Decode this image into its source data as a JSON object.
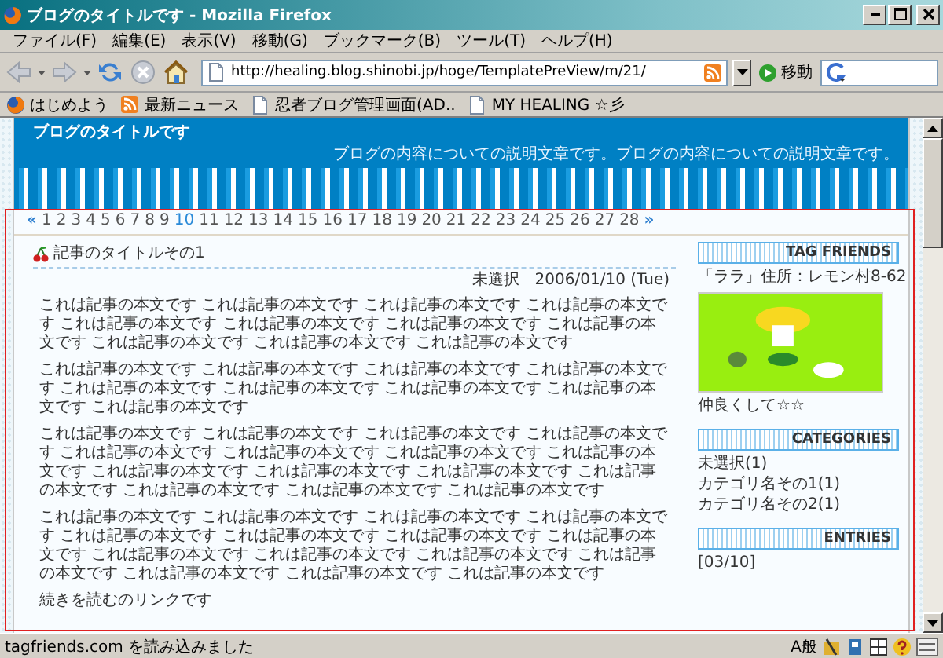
{
  "window": {
    "title": "ブログのタイトルです - Mozilla Firefox"
  },
  "menu": [
    "ファイル(F)",
    "編集(E)",
    "表示(V)",
    "移動(G)",
    "ブックマーク(B)",
    "ツール(T)",
    "ヘルプ(H)"
  ],
  "address_bar": {
    "value": "http://healing.blog.shinobi.jp/hoge/TemplatePreView/m/21/"
  },
  "go_button": "移動",
  "bookmarks": [
    {
      "label": "はじめよう",
      "kind": "browser"
    },
    {
      "label": "最新ニュース",
      "kind": "feed"
    },
    {
      "label": "忍者ブログ管理画面(AD..",
      "kind": "page"
    },
    {
      "label": "MY HEALING ☆彡",
      "kind": "page"
    }
  ],
  "blog": {
    "title": "ブログのタイトルです",
    "description": "ブログの内容についての説明文章です。ブログの内容についての説明文章です。"
  },
  "pager": {
    "prev": "«",
    "next": "»",
    "pages": [
      {
        "label": "1",
        "selected": false
      },
      {
        "label": "2",
        "selected": false
      },
      {
        "label": "3",
        "selected": false
      },
      {
        "label": "4",
        "selected": false
      },
      {
        "label": "5",
        "selected": false
      },
      {
        "label": "6",
        "selected": false
      },
      {
        "label": "7",
        "selected": false
      },
      {
        "label": "8",
        "selected": false
      },
      {
        "label": "9",
        "selected": false
      },
      {
        "label": "10",
        "selected": true
      },
      {
        "label": "11",
        "selected": false
      },
      {
        "label": "12",
        "selected": false
      },
      {
        "label": "13",
        "selected": false
      },
      {
        "label": "14",
        "selected": false
      },
      {
        "label": "15",
        "selected": false
      },
      {
        "label": "16",
        "selected": false
      },
      {
        "label": "17",
        "selected": false
      },
      {
        "label": "18",
        "selected": false
      },
      {
        "label": "19",
        "selected": false
      },
      {
        "label": "20",
        "selected": false
      },
      {
        "label": "21",
        "selected": false
      },
      {
        "label": "22",
        "selected": false
      },
      {
        "label": "23",
        "selected": false
      },
      {
        "label": "24",
        "selected": false
      },
      {
        "label": "25",
        "selected": false
      },
      {
        "label": "26",
        "selected": false
      },
      {
        "label": "27",
        "selected": false
      },
      {
        "label": "28",
        "selected": false
      }
    ]
  },
  "entry": {
    "title": "記事のタイトルその1",
    "category": "未選択",
    "date": "2006/01/10 (Tue)",
    "paragraphs": [
      "これは記事の本文です これは記事の本文です これは記事の本文です これは記事の本文です これは記事の本文です これは記事の本文です これは記事の本文です これは記事の本文です これは記事の本文です これは記事の本文です これは記事の本文です",
      "これは記事の本文です これは記事の本文です これは記事の本文です これは記事の本文です これは記事の本文です これは記事の本文です これは記事の本文です これは記事の本文です これは記事の本文です",
      "これは記事の本文です これは記事の本文です これは記事の本文です これは記事の本文です これは記事の本文です これは記事の本文です これは記事の本文です これは記事の本文です これは記事の本文です これは記事の本文です これは記事の本文です これは記事の本文です これは記事の本文です これは記事の本文です これは記事の本文です",
      "これは記事の本文です これは記事の本文です これは記事の本文です これは記事の本文です これは記事の本文です これは記事の本文です これは記事の本文です これは記事の本文です これは記事の本文です これは記事の本文です これは記事の本文です これは記事の本文です これは記事の本文です これは記事の本文です これは記事の本文です"
    ],
    "more_link": "続きを読むのリンクです"
  },
  "sidebar": [
    {
      "heading": "TAG FRIENDS",
      "items": [
        {
          "kind": "text",
          "text": "「ララ」住所：レモン村8-62"
        },
        {
          "kind": "image"
        },
        {
          "kind": "text",
          "text": "仲良くして☆☆"
        }
      ]
    },
    {
      "heading": "CATEGORIES",
      "items": [
        {
          "kind": "link",
          "text": "未選択(1)"
        },
        {
          "kind": "link",
          "text": "カテゴリ名その1(1)"
        },
        {
          "kind": "link",
          "text": "カテゴリ名その2(1)"
        }
      ]
    },
    {
      "heading": "ENTRIES",
      "items": [
        {
          "kind": "link",
          "text": "[03/10]"
        }
      ]
    }
  ],
  "status_bar": {
    "text": "tagfriends.com を読み込みました",
    "ime": "A般"
  }
}
